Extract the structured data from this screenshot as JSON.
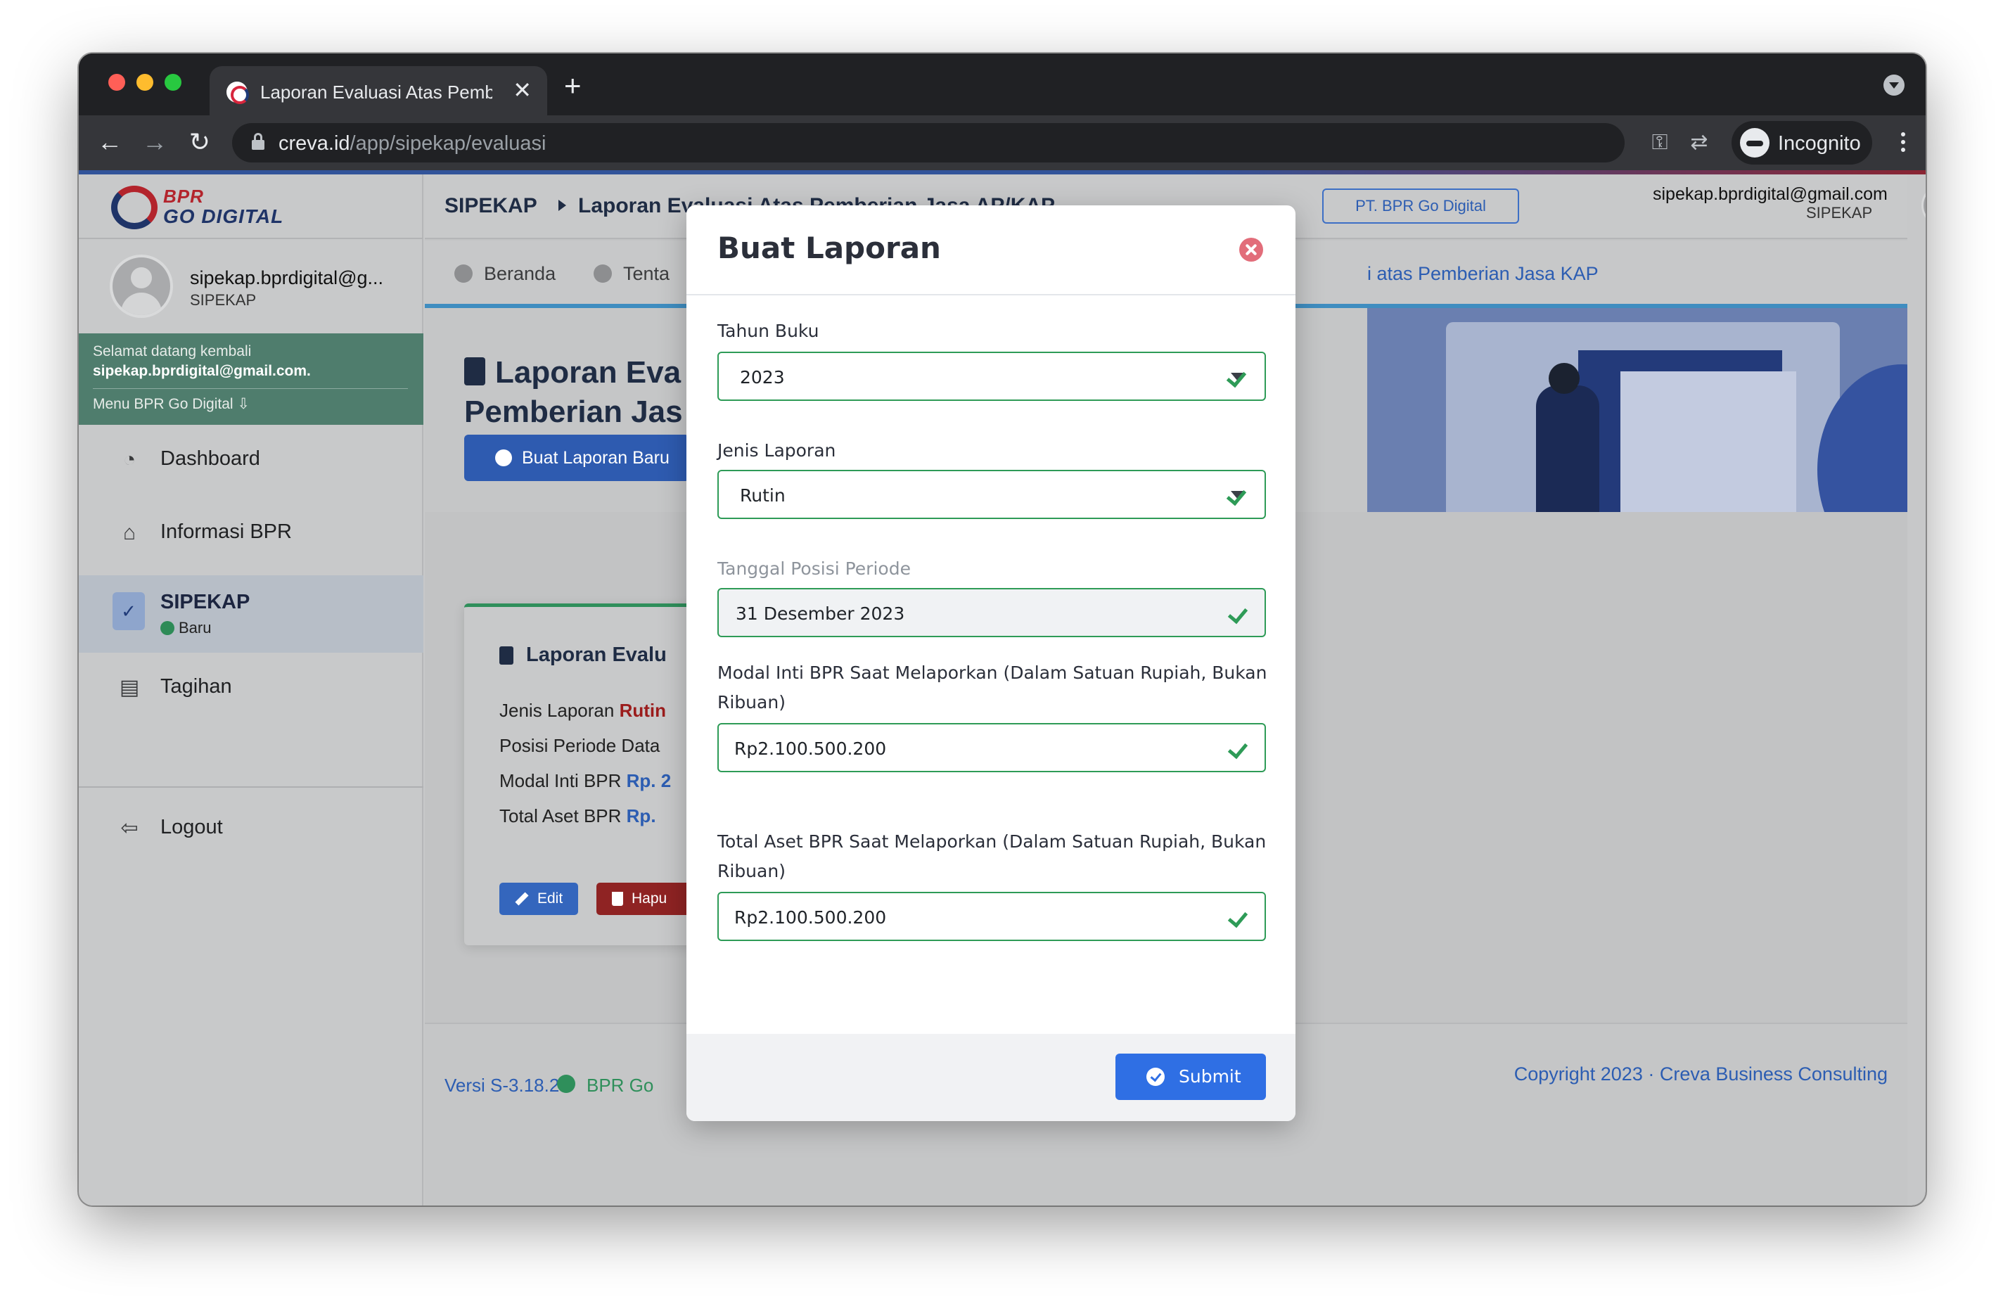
{
  "browser": {
    "tab_title": "Laporan Evaluasi Atas Pemberian Jasa AP/KAP",
    "tab_close": "✕",
    "new_tab": "+",
    "url_host": "creva.id",
    "url_path": "/app/sipekap/evaluasi",
    "profile_label": "Incognito",
    "icons": [
      "key-icon",
      "translate-icon",
      "zoom-icon",
      "star-icon"
    ]
  },
  "sidebar": {
    "brand_line1": "BPR",
    "brand_line2": "GO DIGITAL",
    "user_email": "sipekap.bprdigital@g...",
    "user_role": "SIPEKAP",
    "welcome_line1": "Selamat datang kembali",
    "welcome_email": "sipekap.bprdigital@gmail.com.",
    "welcome_menu": "Menu BPR Go Digital ⇩",
    "items": [
      {
        "label": "Dashboard",
        "icon": "gauge-icon"
      },
      {
        "label": "Informasi BPR",
        "icon": "bank-icon"
      },
      {
        "label": "SIPEKAP",
        "icon": "clipboard-check-icon",
        "badge": "Baru"
      },
      {
        "label": "Tagihan",
        "icon": "invoice-icon"
      },
      {
        "label": "Logout",
        "icon": "logout-icon"
      }
    ]
  },
  "header": {
    "crumb_root": "SIPEKAP",
    "crumb_page": "Laporan Evaluasi Atas Pemberian Jasa AP/KAP",
    "org_button": "PT. BPR Go Digital",
    "user_email": "sipekap.bprdigital@gmail.com",
    "user_role": "SIPEKAP"
  },
  "subnav": {
    "home": "Beranda",
    "about": "Tenta",
    "current": "i atas Pemberian Jasa KAP"
  },
  "hero": {
    "title_line1": "Laporan Eva",
    "title_line2": "Pemberian Jas",
    "create_button": "Buat Laporan Baru"
  },
  "card": {
    "title": "Laporan Evalu",
    "jenis_label": "Jenis Laporan",
    "jenis_value": "Rutin",
    "posisi_label": "Posisi Periode Data",
    "modal_label": "Modal Inti BPR",
    "modal_value": "Rp. 2",
    "aset_label": "Total Aset BPR",
    "aset_value": "Rp.",
    "edit_button": "Edit",
    "delete_button": "Hapu"
  },
  "footer": {
    "version": "Versi S-3.18.2",
    "org": "BPR Go",
    "copyright": "Copyright 2023 · Creva Business Consulting"
  },
  "modal": {
    "title": "Buat Laporan",
    "tahun_label": "Tahun Buku",
    "tahun_value": "2023",
    "jenis_label": "Jenis Laporan",
    "jenis_value": "Rutin",
    "tanggal_label": "Tanggal Posisi Periode",
    "tanggal_value": "31 Desember 2023",
    "modal_label": "Modal Inti BPR Saat Melaporkan (Dalam Satuan Rupiah, Bukan Ribuan)",
    "modal_value": "Rp2.100.500.200",
    "aset_label": "Total Aset BPR Saat Melaporkan (Dalam Satuan Rupiah, Bukan Ribuan)",
    "aset_value": "Rp2.100.500.200",
    "submit_label": "Submit"
  },
  "colors": {
    "valid_border": "#2e9b57",
    "primary": "#2f6fe4",
    "close": "#e26d7a"
  }
}
